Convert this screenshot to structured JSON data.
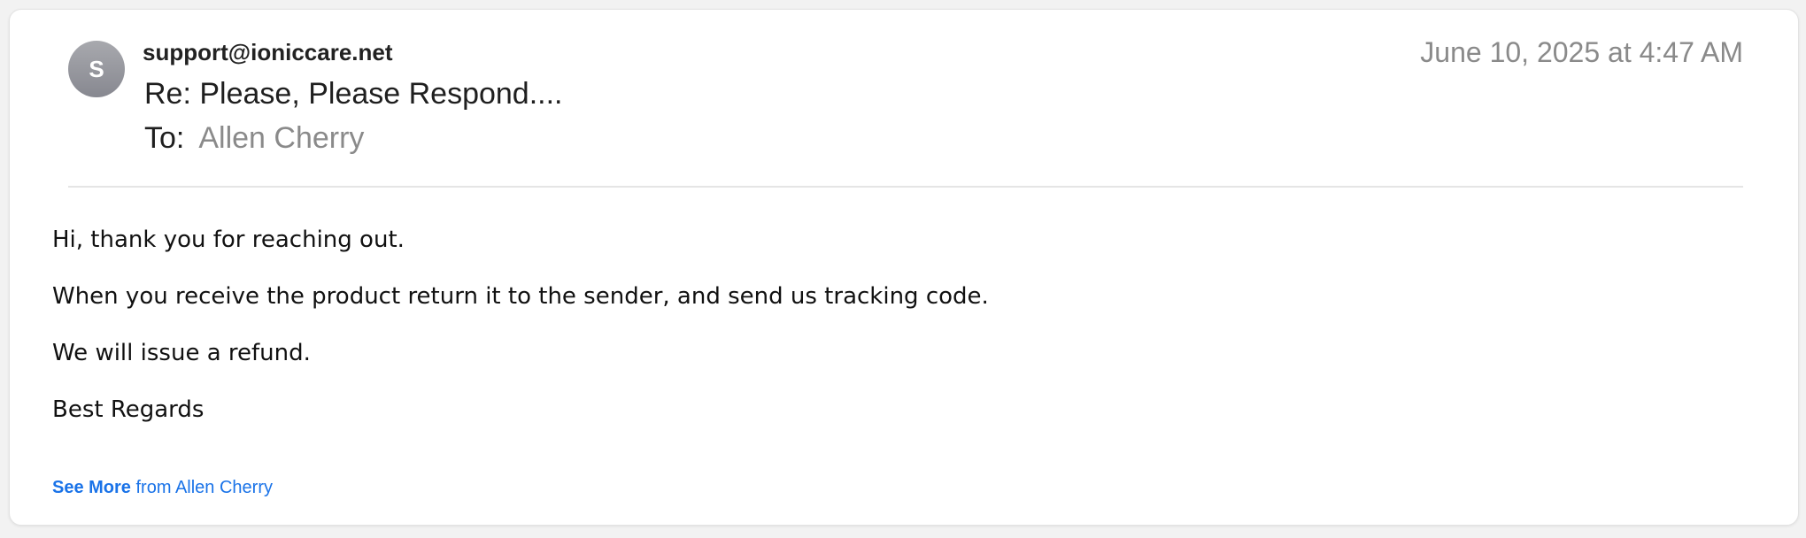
{
  "email": {
    "avatar_initial": "S",
    "sender": "support@ioniccare.net",
    "date": "June 10, 2025 at 4:47 AM",
    "subject": "Re: Please, Please Respond....",
    "to_label": "To:",
    "to_value": "Allen Cherry",
    "body": [
      "Hi, thank you for reaching out.",
      "When you receive the product return it to the sender, and send us tracking code.",
      "We will issue a refund.",
      "Best Regards"
    ],
    "see_more": {
      "label": "See More",
      "suffix": "from Allen Cherry"
    }
  },
  "colors": {
    "link": "#1a73e8",
    "muted": "#8a8a8a",
    "avatar": "#92939a"
  }
}
